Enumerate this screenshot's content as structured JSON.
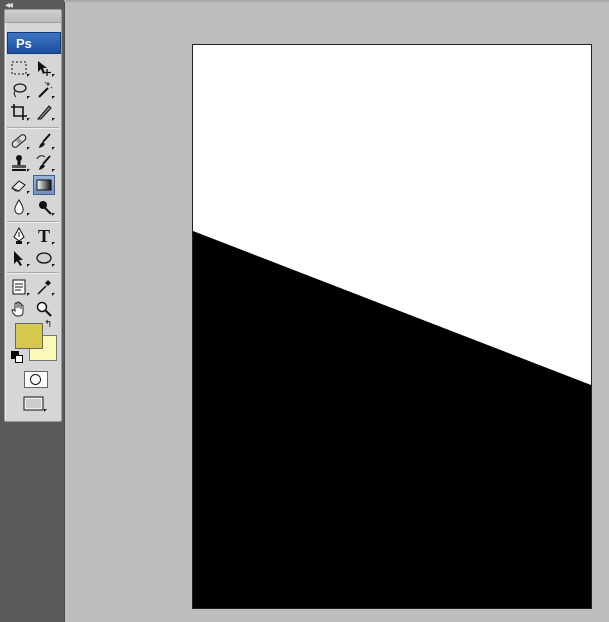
{
  "app": {
    "logo_text": "Ps"
  },
  "toolbox": {
    "collapse_label": "◂◂",
    "tools": [
      {
        "name": "rectangular-marquee-tool",
        "icon": "marquee-icon"
      },
      {
        "name": "move-tool",
        "icon": "move-icon"
      },
      {
        "name": "lasso-tool",
        "icon": "lasso-icon"
      },
      {
        "name": "magic-wand-tool",
        "icon": "magic-wand-icon"
      },
      {
        "name": "crop-tool",
        "icon": "crop-icon"
      },
      {
        "name": "slice-tool",
        "icon": "slice-icon"
      },
      {
        "name": "healing-brush-tool",
        "icon": "bandage-icon"
      },
      {
        "name": "brush-tool",
        "icon": "brush-icon"
      },
      {
        "name": "clone-stamp-tool",
        "icon": "stamp-icon"
      },
      {
        "name": "history-brush-tool",
        "icon": "history-brush-icon"
      },
      {
        "name": "eraser-tool",
        "icon": "eraser-icon"
      },
      {
        "name": "gradient-tool",
        "icon": "gradient-icon",
        "selected": true
      },
      {
        "name": "blur-tool",
        "icon": "drop-icon"
      },
      {
        "name": "dodge-tool",
        "icon": "dodge-icon"
      },
      {
        "name": "pen-tool",
        "icon": "pen-icon"
      },
      {
        "name": "type-tool",
        "icon": "type-icon"
      },
      {
        "name": "path-selection-tool",
        "icon": "arrow-icon"
      },
      {
        "name": "ellipse-tool",
        "icon": "ellipse-icon"
      },
      {
        "name": "notes-tool",
        "icon": "notes-icon"
      },
      {
        "name": "eyedropper-tool",
        "icon": "eyedropper-icon"
      },
      {
        "name": "hand-tool",
        "icon": "hand-icon"
      },
      {
        "name": "zoom-tool",
        "icon": "magnifier-icon"
      }
    ],
    "type_tool_glyph": "T",
    "swap_glyph": "↰",
    "foreground_color": "#d4c84e",
    "background_color": "#fbf8b8"
  },
  "canvas": {
    "background": "#ffffff",
    "fill": "#000000"
  }
}
